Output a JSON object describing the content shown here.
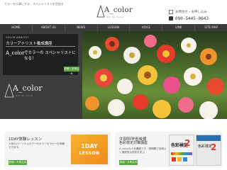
{
  "header": {
    "tagline": "カラーを仕事にする・スペシャリストを目指す",
    "logo_text": "A_color",
    "logo_sub": "Art de Color",
    "contact_label": "お問合せ・お申し込み",
    "phone": "090-5445-0643"
  },
  "nav": {
    "items": [
      "HOME",
      "ABOUT US",
      "NEWS",
      "LESSON",
      "VOICE",
      "LINK",
      "SITE MAP"
    ]
  },
  "hero": {
    "panel_small": "COLOR ANALYST",
    "panel_title": "カラーアナリスト養成講座",
    "panel_brand": "A_color",
    "panel_copy": "でカラーの スペシャリストになる！",
    "panel_button": "詳細・お申込み",
    "brand_text": "A_color",
    "brand_sub": "Art de Color"
  },
  "cards": [
    {
      "title": "1DAY体験レッスン",
      "desc": "人気のパーソナルカラーやカラーセラピーを体験できます。",
      "button": "詳細・お申込み",
      "image_big": "1DAY",
      "image_sub": "LESSON"
    },
    {
      "title": "文部科学省後援",
      "title2": "色彩検定対策講座",
      "desc": "A_colorの人気講座です。短期間で効率よく実践的な色彩を学ぶ",
      "button": "詳細・お申込み",
      "book1_title": "色彩検定",
      "book1_num": "2",
      "book2_title": "色彩検定",
      "book2_num": "2"
    }
  ],
  "colors": {
    "nav_bg": "#3a3a3a",
    "accent_green": "#5aa63a",
    "orange": "#f5b22d"
  }
}
